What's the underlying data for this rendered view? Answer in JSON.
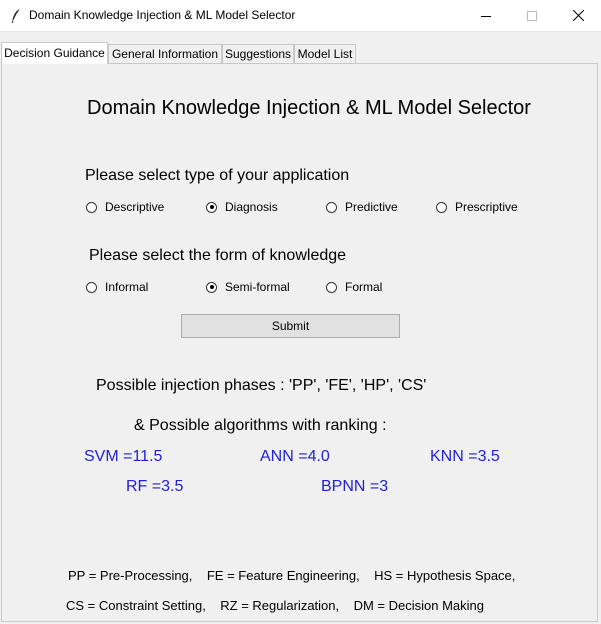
{
  "window": {
    "title": "Domain Knowledge Injection & ML Model Selector"
  },
  "tabs": [
    {
      "label": "Decision Guidance"
    },
    {
      "label": "General Information"
    },
    {
      "label": "Suggestions"
    },
    {
      "label": "Model List"
    }
  ],
  "main": {
    "heading": "Domain Knowledge Injection & ML Model Selector",
    "app_type_prompt": "Please select type of your application",
    "app_types": [
      "Descriptive",
      "Diagnosis",
      "Predictive",
      "Prescriptive"
    ],
    "app_type_selected": "Diagnosis",
    "knowledge_prompt": "Please select the form of knowledge",
    "knowledge_forms": [
      "Informal",
      "Semi-formal",
      "Formal"
    ],
    "knowledge_selected": "Semi-formal",
    "submit_label": "Submit",
    "phases_text": "Possible injection phases : 'PP', 'FE', 'HP', 'CS'",
    "algorithms_heading": "& Possible algorithms with ranking :",
    "algorithms": [
      "SVM =11.5",
      "ANN =4.0",
      "KNN =3.5",
      "RF =3.5",
      "BPNN =3"
    ],
    "legend_line1": "PP = Pre-Processing,    FE = Feature Engineering,    HS = Hypothesis Space,",
    "legend_line2": "CS = Constraint Setting,    RZ = Regularization,    DM = Decision Making"
  },
  "colors": {
    "algorithm_text": "#1f1fd6",
    "background": "#f0f0f0"
  }
}
